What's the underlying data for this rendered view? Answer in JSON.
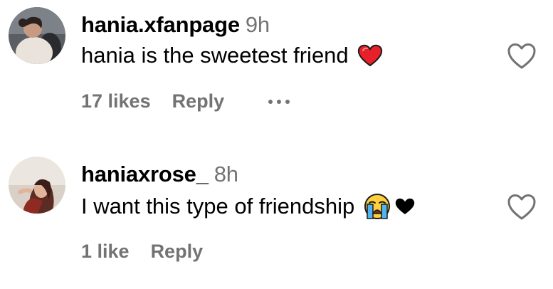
{
  "comments": [
    {
      "username": "hania.xfanpage",
      "time": "9h",
      "text": "hania is the sweetest friend",
      "emojis": [
        "red-heart"
      ],
      "likes": "17 likes",
      "reply_label": "Reply",
      "has_more": true
    },
    {
      "username": "haniaxrose_",
      "time": "8h",
      "text": "I want this type of friendship",
      "emojis": [
        "loudly-crying-face",
        "black-heart"
      ],
      "likes": "1 like",
      "reply_label": "Reply",
      "has_more": false
    }
  ],
  "colors": {
    "secondary_text": "#737373",
    "red_heart": "#e8202a",
    "black_heart": "#000000"
  }
}
